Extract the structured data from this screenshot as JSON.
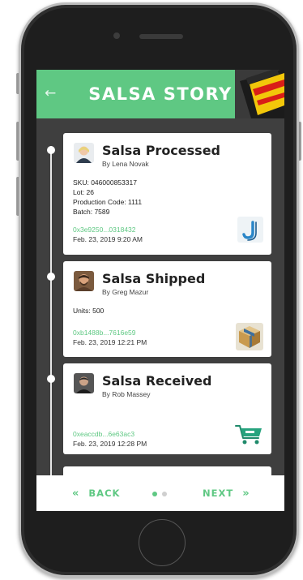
{
  "header": {
    "back_glyph": "←",
    "title": "SALSA STORY"
  },
  "events": [
    {
      "title": "Salsa Processed",
      "by": "By Lena Novak",
      "details": [
        "SKU: 046000853317",
        "Lot: 26",
        "Production Code: 1111",
        "Batch: 7589"
      ],
      "hash": "0x3e9250...0318432",
      "timestamp": "Feb. 23, 2019 9:20 AM",
      "logo": "j-logo-icon"
    },
    {
      "title": "Salsa Shipped",
      "by": "By Greg Mazur",
      "details": [
        "Units: 500"
      ],
      "hash": "0xb1488b...7616e59",
      "timestamp": "Feb. 23, 2019 12:21 PM",
      "logo": "package-box-icon"
    },
    {
      "title": "Salsa Received",
      "by": "By Rob Massey",
      "details": [],
      "hash": "0xeaccdb...6e63ac3",
      "timestamp": "Feb. 23, 2019 12:28 PM",
      "logo": "shopping-cart-icon"
    }
  ],
  "footer": {
    "back_label": "BACK",
    "next_label": "NEXT",
    "back_chevron": "«",
    "next_chevron": "»",
    "page_current": 1,
    "page_total": 2
  },
  "colors": {
    "accent": "#5fc883",
    "screen_bg": "#3f3f3f",
    "card_bg": "#ffffff"
  }
}
